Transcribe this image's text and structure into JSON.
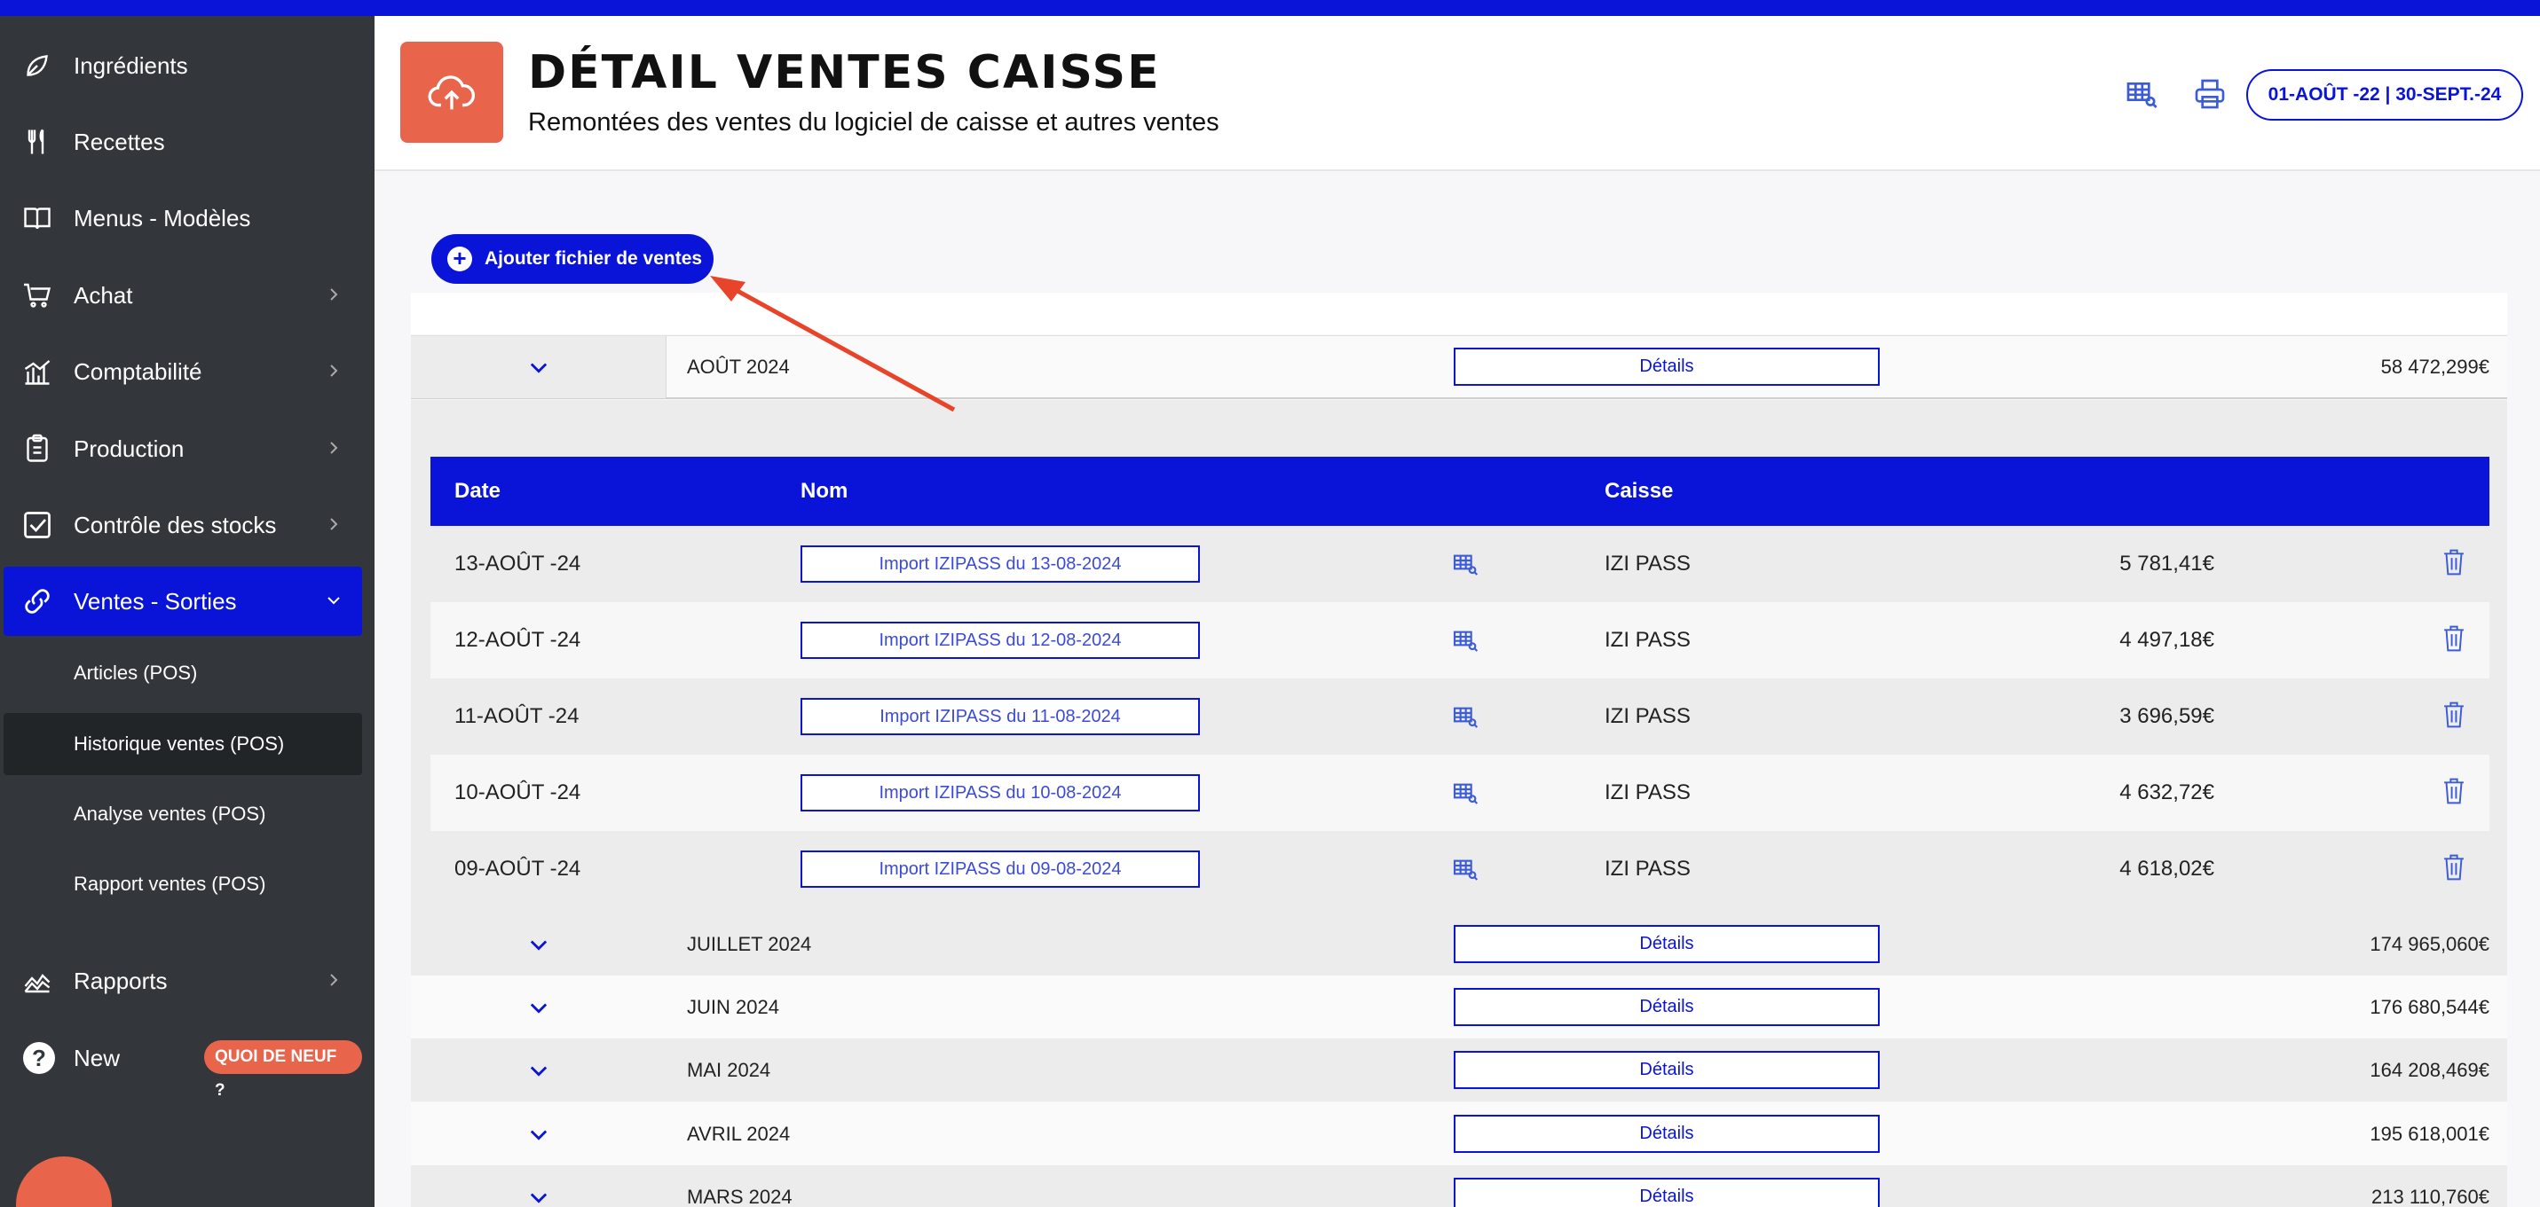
{
  "sidebar": {
    "items": [
      {
        "label": "Ingrédients",
        "icon": "leaf-icon"
      },
      {
        "label": "Recettes",
        "icon": "utensils-icon"
      },
      {
        "label": "Menus - Modèles",
        "icon": "book-icon"
      },
      {
        "label": "Achat",
        "icon": "cart-icon"
      },
      {
        "label": "Comptabilité",
        "icon": "chart-bar-icon"
      },
      {
        "label": "Production",
        "icon": "clipboard-icon"
      },
      {
        "label": "Contrôle des stocks",
        "icon": "checkbox-icon"
      },
      {
        "label": "Ventes - Sorties",
        "icon": "link-icon"
      },
      {
        "label": "Rapports",
        "icon": "area-chart-icon"
      },
      {
        "label": "New",
        "icon": "help-icon"
      }
    ],
    "subitems": [
      "Articles (POS)",
      "Historique ventes (POS)",
      "Analyse ventes (POS)",
      "Rapport ventes (POS)"
    ],
    "new_badge": "QUOI DE NEUF ?"
  },
  "header": {
    "title": "DÉTAIL VENTES CAISSE",
    "subtitle": "Remontées des ventes du logiciel de caisse et autres ventes",
    "date_range": "01-AOÛT -22 | 30-SEPT.-24"
  },
  "actions": {
    "add_file": "Ajouter fichier de ventes"
  },
  "months": [
    {
      "label": "AOÛT 2024",
      "details": "Détails",
      "total": "58 472,299€"
    },
    {
      "label": "JUILLET 2024",
      "details": "Détails",
      "total": "174 965,060€"
    },
    {
      "label": "JUIN 2024",
      "details": "Détails",
      "total": "176 680,544€"
    },
    {
      "label": "MAI 2024",
      "details": "Détails",
      "total": "164 208,469€"
    },
    {
      "label": "AVRIL 2024",
      "details": "Détails",
      "total": "195 618,001€"
    },
    {
      "label": "MARS 2024",
      "details": "Détails",
      "total": "213 110,760€"
    }
  ],
  "detail_table": {
    "headers": {
      "date": "Date",
      "nom": "Nom",
      "caisse": "Caisse"
    },
    "rows": [
      {
        "date": "13-AOÛT -24",
        "nom": "Import IZIPASS du 13-08-2024",
        "caisse": "IZI PASS",
        "montant": "5 781,41€"
      },
      {
        "date": "12-AOÛT -24",
        "nom": "Import IZIPASS du 12-08-2024",
        "caisse": "IZI PASS",
        "montant": "4 497,18€"
      },
      {
        "date": "11-AOÛT -24",
        "nom": "Import IZIPASS du 11-08-2024",
        "caisse": "IZI PASS",
        "montant": "3 696,59€"
      },
      {
        "date": "10-AOÛT -24",
        "nom": "Import IZIPASS du 10-08-2024",
        "caisse": "IZI PASS",
        "montant": "4 632,72€"
      },
      {
        "date": "09-AOÛT -24",
        "nom": "Import IZIPASS du 09-08-2024",
        "caisse": "IZI PASS",
        "montant": "4 618,02€"
      }
    ]
  },
  "colors": {
    "primary": "#0a14d8",
    "accent": "#e8644a",
    "sidebar": "#33373b"
  }
}
